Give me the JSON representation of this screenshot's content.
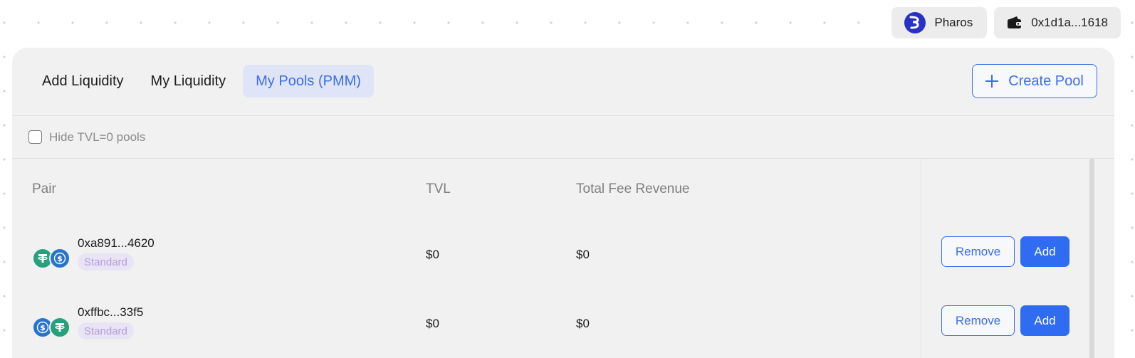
{
  "header": {
    "chain_name": "Pharos",
    "chain_icon": "pharos-logo-icon",
    "wallet_address": "0x1d1a...1618",
    "wallet_icon": "wallet-icon"
  },
  "tabs": [
    {
      "label": "Add Liquidity",
      "active": false
    },
    {
      "label": "My Liquidity",
      "active": false
    },
    {
      "label": "My Pools (PMM)",
      "active": true
    }
  ],
  "create_pool_label": "Create Pool",
  "filter": {
    "label": "Hide TVL=0 pools",
    "checked": false
  },
  "table": {
    "columns": [
      "Pair",
      "TVL",
      "Total Fee Revenue"
    ],
    "rows": [
      {
        "address": "0xa891...4620",
        "tag": "Standard",
        "tokens": [
          "usdt-icon",
          "usdc-icon"
        ],
        "tvl": "$0",
        "fee_revenue": "$0",
        "remove_label": "Remove",
        "add_label": "Add"
      },
      {
        "address": "0xffbc...33f5",
        "tag": "Standard",
        "tokens": [
          "usdc-icon",
          "usdt-icon"
        ],
        "tvl": "$0",
        "fee_revenue": "$0",
        "remove_label": "Remove",
        "add_label": "Add"
      }
    ]
  },
  "colors": {
    "accent": "#3b6fe8",
    "add_button": "#2f6cf2",
    "tag_text": "#b39be0",
    "usdt": "#26a17b",
    "usdc": "#2775ca"
  }
}
